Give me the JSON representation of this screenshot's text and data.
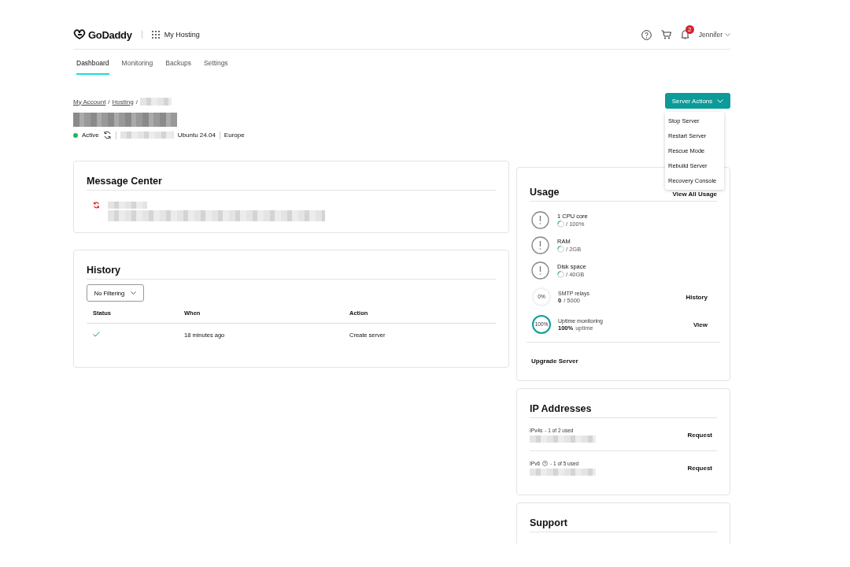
{
  "header": {
    "logo": "GoDaddy",
    "product": "My Hosting",
    "notification_count": "2",
    "user": "Jennifer"
  },
  "tabs": [
    {
      "label": "Dashboard",
      "selected": true
    },
    {
      "label": "Monitoring",
      "selected": false
    },
    {
      "label": "Backups",
      "selected": false
    },
    {
      "label": "Settings",
      "selected": false
    }
  ],
  "breadcrumb": {
    "items": [
      "My Account",
      "Hosting"
    ],
    "separator": "/"
  },
  "server": {
    "status": "Active",
    "os": "Ubuntu 24.04",
    "region": "Europe"
  },
  "server_actions": {
    "label": "Server Actions",
    "menu": [
      "Stop Server",
      "Restart Server",
      "Rescue Mode",
      "Rebuild Server",
      "Recovery Console"
    ]
  },
  "message_center": {
    "title": "Message Center"
  },
  "history": {
    "title": "History",
    "filter": "No Filtering",
    "columns": [
      "Status",
      "When",
      "Action"
    ],
    "rows": [
      {
        "kind": "success",
        "when": "18 minutes ago",
        "action": "Create server"
      }
    ]
  },
  "usage": {
    "title": "Usage",
    "link": "View All Usage",
    "items": [
      {
        "kind": "resource",
        "label": "1 CPU core",
        "value": "/ 100%"
      },
      {
        "kind": "resource",
        "label": "RAM",
        "value": "/ 2GB"
      },
      {
        "kind": "resource",
        "label": "Disk space",
        "value": "/ 40GB"
      },
      {
        "kind": "meter",
        "ring_label": "0%",
        "level": 0,
        "label": "SMTP relays",
        "value_bold": "0",
        "value": "/ 5000",
        "link": "History"
      },
      {
        "kind": "meter",
        "ring_label": "100%",
        "level": 1,
        "label": "Uptime monitoring",
        "value_bold": "100%",
        "value": "uptime",
        "link": "View"
      }
    ],
    "upgrade": "Upgrade Server"
  },
  "ip_addresses": {
    "title": "IP Addresses",
    "rows": [
      {
        "label": "IPv4s",
        "help": false,
        "usage": "- 1 of 2 used",
        "action": "Request"
      },
      {
        "label": "IPv6",
        "help": true,
        "usage": "- 1 of 5 used",
        "action": "Request"
      }
    ]
  },
  "support": {
    "title": "Support"
  }
}
